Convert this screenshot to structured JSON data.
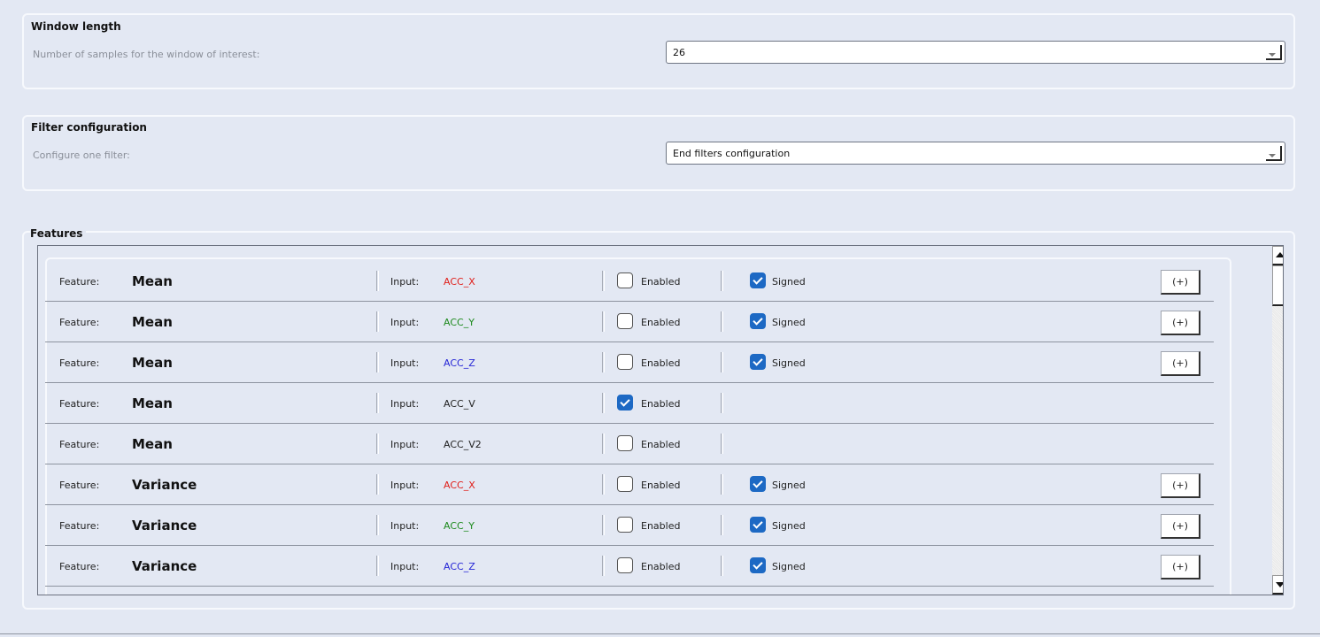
{
  "window_length": {
    "title": "Window length",
    "label": "Number of samples for the window of interest:",
    "value": "26"
  },
  "filter_config": {
    "title": "Filter configuration",
    "label": "Configure one filter:",
    "value": "End filters configuration"
  },
  "features": {
    "title": "Features",
    "feature_label": "Feature:",
    "input_label": "Input:",
    "enabled_label": "Enabled",
    "signed_label": "Signed",
    "plus_label": "(+)",
    "input_colors": {
      "ACC_X": "#e0201b",
      "ACC_Y": "#1d8a1d",
      "ACC_Z": "#2525d6",
      "default": "#222222"
    },
    "rows": [
      {
        "feature": "Mean",
        "input": "ACC_X",
        "enabled": false,
        "signed": true
      },
      {
        "feature": "Mean",
        "input": "ACC_Y",
        "enabled": false,
        "signed": true
      },
      {
        "feature": "Mean",
        "input": "ACC_Z",
        "enabled": false,
        "signed": true
      },
      {
        "feature": "Mean",
        "input": "ACC_V",
        "enabled": true,
        "signed": null
      },
      {
        "feature": "Mean",
        "input": "ACC_V2",
        "enabled": false,
        "signed": null
      },
      {
        "feature": "Variance",
        "input": "ACC_X",
        "enabled": false,
        "signed": true
      },
      {
        "feature": "Variance",
        "input": "ACC_Y",
        "enabled": false,
        "signed": true
      },
      {
        "feature": "Variance",
        "input": "ACC_Z",
        "enabled": false,
        "signed": true
      }
    ]
  }
}
